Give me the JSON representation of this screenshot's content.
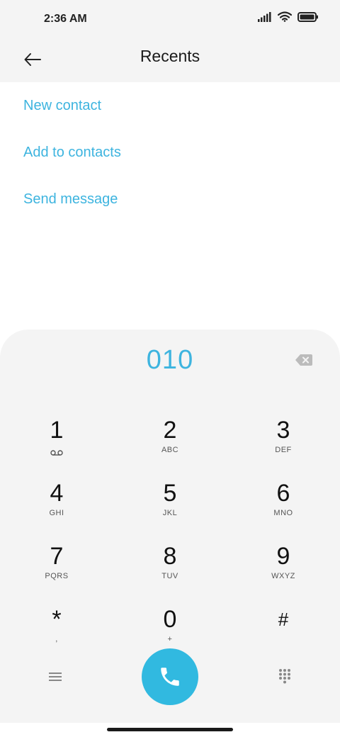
{
  "status_bar": {
    "time": "2:36 AM",
    "icons": [
      "signal-icon",
      "wifi-icon",
      "battery-icon"
    ]
  },
  "header": {
    "title": "Recents",
    "back_icon": "arrow-left-icon"
  },
  "actions": [
    {
      "label": "New contact"
    },
    {
      "label": "Add to contacts"
    },
    {
      "label": "Send message"
    }
  ],
  "dialpad": {
    "number": "010",
    "backspace_icon": "backspace-icon",
    "keys": [
      {
        "digit": "1",
        "letters": "",
        "sub_icon": "voicemail-icon"
      },
      {
        "digit": "2",
        "letters": "ABC"
      },
      {
        "digit": "3",
        "letters": "DEF"
      },
      {
        "digit": "4",
        "letters": "GHI"
      },
      {
        "digit": "5",
        "letters": "JKL"
      },
      {
        "digit": "6",
        "letters": "MNO"
      },
      {
        "digit": "7",
        "letters": "PQRS"
      },
      {
        "digit": "8",
        "letters": "TUV"
      },
      {
        "digit": "9",
        "letters": "WXYZ"
      },
      {
        "digit": "*",
        "letters": ","
      },
      {
        "digit": "0",
        "letters": "+"
      },
      {
        "digit": "#",
        "letters": ""
      }
    ],
    "bottom_icons": [
      "menu-icon",
      "phone-icon",
      "keypad-icon"
    ]
  },
  "colors": {
    "accent": "#3db4df",
    "call_button": "#31b9e0",
    "panel_background": "#f4f4f4"
  }
}
